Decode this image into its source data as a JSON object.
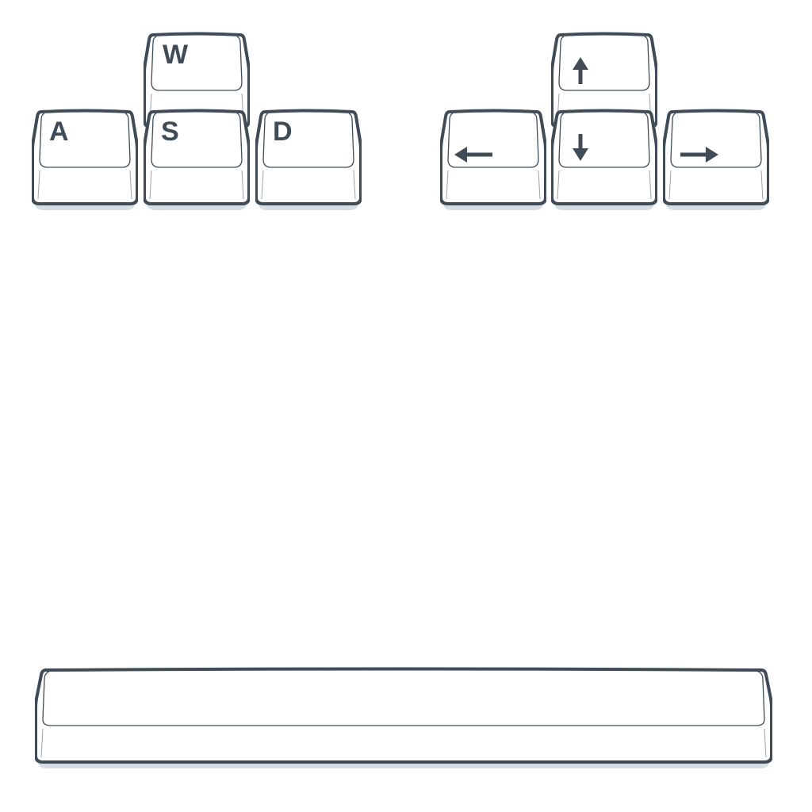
{
  "wasd_cluster": {
    "up": {
      "label": "W"
    },
    "left": {
      "label": "A"
    },
    "down": {
      "label": "S"
    },
    "right": {
      "label": "D"
    }
  },
  "arrow_cluster": {
    "up": {
      "icon": "arrow-up-icon"
    },
    "left": {
      "icon": "arrow-left-icon"
    },
    "down": {
      "icon": "arrow-down-icon"
    },
    "right": {
      "icon": "arrow-right-icon"
    }
  },
  "spacebar": {
    "label": ""
  },
  "colors": {
    "outline": "#3f4b57",
    "legend": "#3f4b57",
    "key_face": "#ffffff",
    "key_shadow": "#d7dde3",
    "background": "#ffffff"
  }
}
